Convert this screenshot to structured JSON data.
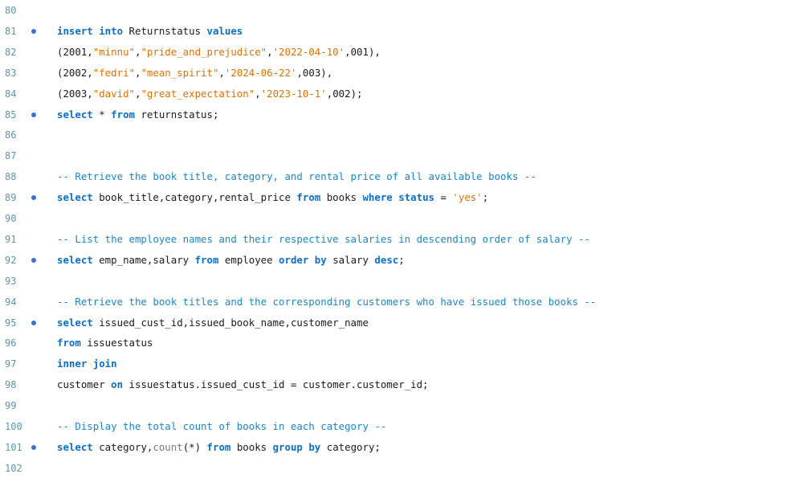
{
  "editor": {
    "colors": {
      "keyword": "#0a6fc9",
      "text": "#1a1a1a",
      "string": "#e07000",
      "comment": "#1a86c9",
      "function": "#7a7a7a",
      "line_number": "#5d96a7",
      "statement_marker": "#3b6fd6"
    },
    "lines": [
      {
        "num": "80",
        "marker": false,
        "tokens": []
      },
      {
        "num": "81",
        "marker": true,
        "tokens": [
          {
            "t": "insert into",
            "c": "kw"
          },
          {
            "t": " Returnstatus ",
            "c": "tx"
          },
          {
            "t": "values",
            "c": "kw"
          }
        ]
      },
      {
        "num": "82",
        "marker": false,
        "tokens": [
          {
            "t": "(2001,",
            "c": "tx"
          },
          {
            "t": "\"minnu\"",
            "c": "st"
          },
          {
            "t": ",",
            "c": "tx"
          },
          {
            "t": "\"pride_and_prejudice\"",
            "c": "st"
          },
          {
            "t": ",",
            "c": "tx"
          },
          {
            "t": "'2022-04-10'",
            "c": "st"
          },
          {
            "t": ",001),",
            "c": "tx"
          }
        ]
      },
      {
        "num": "83",
        "marker": false,
        "tokens": [
          {
            "t": "(2002,",
            "c": "tx"
          },
          {
            "t": "\"fedri\"",
            "c": "st"
          },
          {
            "t": ",",
            "c": "tx"
          },
          {
            "t": "\"mean_spirit\"",
            "c": "st"
          },
          {
            "t": ",",
            "c": "tx"
          },
          {
            "t": "'2024-06-22'",
            "c": "st"
          },
          {
            "t": ",003),",
            "c": "tx"
          }
        ]
      },
      {
        "num": "84",
        "marker": false,
        "tokens": [
          {
            "t": "(2003,",
            "c": "tx"
          },
          {
            "t": "\"david\"",
            "c": "st"
          },
          {
            "t": ",",
            "c": "tx"
          },
          {
            "t": "\"great_expectation\"",
            "c": "st"
          },
          {
            "t": ",",
            "c": "tx"
          },
          {
            "t": "'2023-10-1'",
            "c": "st"
          },
          {
            "t": ",002);",
            "c": "tx"
          }
        ]
      },
      {
        "num": "85",
        "marker": true,
        "tokens": [
          {
            "t": "select",
            "c": "kw"
          },
          {
            "t": " * ",
            "c": "tx"
          },
          {
            "t": "from",
            "c": "kw"
          },
          {
            "t": " returnstatus;",
            "c": "tx"
          }
        ]
      },
      {
        "num": "86",
        "marker": false,
        "tokens": []
      },
      {
        "num": "87",
        "marker": false,
        "tokens": []
      },
      {
        "num": "88",
        "marker": false,
        "tokens": [
          {
            "t": "-- Retrieve the book title, category, and rental price of all available books --",
            "c": "cm"
          }
        ]
      },
      {
        "num": "89",
        "marker": true,
        "tokens": [
          {
            "t": "select",
            "c": "kw"
          },
          {
            "t": " book_title,category,rental_price ",
            "c": "tx"
          },
          {
            "t": "from",
            "c": "kw"
          },
          {
            "t": " books ",
            "c": "tx"
          },
          {
            "t": "where",
            "c": "kw"
          },
          {
            "t": " ",
            "c": "tx"
          },
          {
            "t": "status",
            "c": "kw"
          },
          {
            "t": " = ",
            "c": "tx"
          },
          {
            "t": "'yes'",
            "c": "st"
          },
          {
            "t": ";",
            "c": "tx"
          }
        ]
      },
      {
        "num": "90",
        "marker": false,
        "tokens": []
      },
      {
        "num": "91",
        "marker": false,
        "tokens": [
          {
            "t": "-- List the employee names and their respective salaries in descending order of salary --",
            "c": "cm"
          }
        ]
      },
      {
        "num": "92",
        "marker": true,
        "tokens": [
          {
            "t": "select",
            "c": "kw"
          },
          {
            "t": " emp_name,salary ",
            "c": "tx"
          },
          {
            "t": "from",
            "c": "kw"
          },
          {
            "t": " employee ",
            "c": "tx"
          },
          {
            "t": "order by",
            "c": "kw"
          },
          {
            "t": " salary ",
            "c": "tx"
          },
          {
            "t": "desc",
            "c": "kw"
          },
          {
            "t": ";",
            "c": "tx"
          }
        ]
      },
      {
        "num": "93",
        "marker": false,
        "tokens": []
      },
      {
        "num": "94",
        "marker": false,
        "tokens": [
          {
            "t": "-- Retrieve the book titles and the corresponding customers who have issued those books --",
            "c": "cm"
          }
        ]
      },
      {
        "num": "95",
        "marker": true,
        "tokens": [
          {
            "t": "select",
            "c": "kw"
          },
          {
            "t": " issued_cust_id,issued_book_name,customer_name",
            "c": "tx"
          }
        ]
      },
      {
        "num": "96",
        "marker": false,
        "tokens": [
          {
            "t": "from",
            "c": "kw"
          },
          {
            "t": " issuestatus",
            "c": "tx"
          }
        ]
      },
      {
        "num": "97",
        "marker": false,
        "tokens": [
          {
            "t": "inner join",
            "c": "kw"
          }
        ]
      },
      {
        "num": "98",
        "marker": false,
        "tokens": [
          {
            "t": "customer ",
            "c": "tx"
          },
          {
            "t": "on",
            "c": "kw"
          },
          {
            "t": " issuestatus.issued_cust_id = customer.customer_id;",
            "c": "tx"
          }
        ]
      },
      {
        "num": "99",
        "marker": false,
        "tokens": []
      },
      {
        "num": "100",
        "marker": false,
        "tokens": [
          {
            "t": "-- Display the total count of books in each category --",
            "c": "cm"
          }
        ]
      },
      {
        "num": "101",
        "marker": true,
        "tokens": [
          {
            "t": "select",
            "c": "kw"
          },
          {
            "t": " category,",
            "c": "tx"
          },
          {
            "t": "count",
            "c": "fn"
          },
          {
            "t": "(*) ",
            "c": "tx"
          },
          {
            "t": "from",
            "c": "kw"
          },
          {
            "t": " books ",
            "c": "tx"
          },
          {
            "t": "group by",
            "c": "kw"
          },
          {
            "t": " category;",
            "c": "tx"
          }
        ]
      },
      {
        "num": "102",
        "marker": false,
        "tokens": []
      }
    ]
  }
}
